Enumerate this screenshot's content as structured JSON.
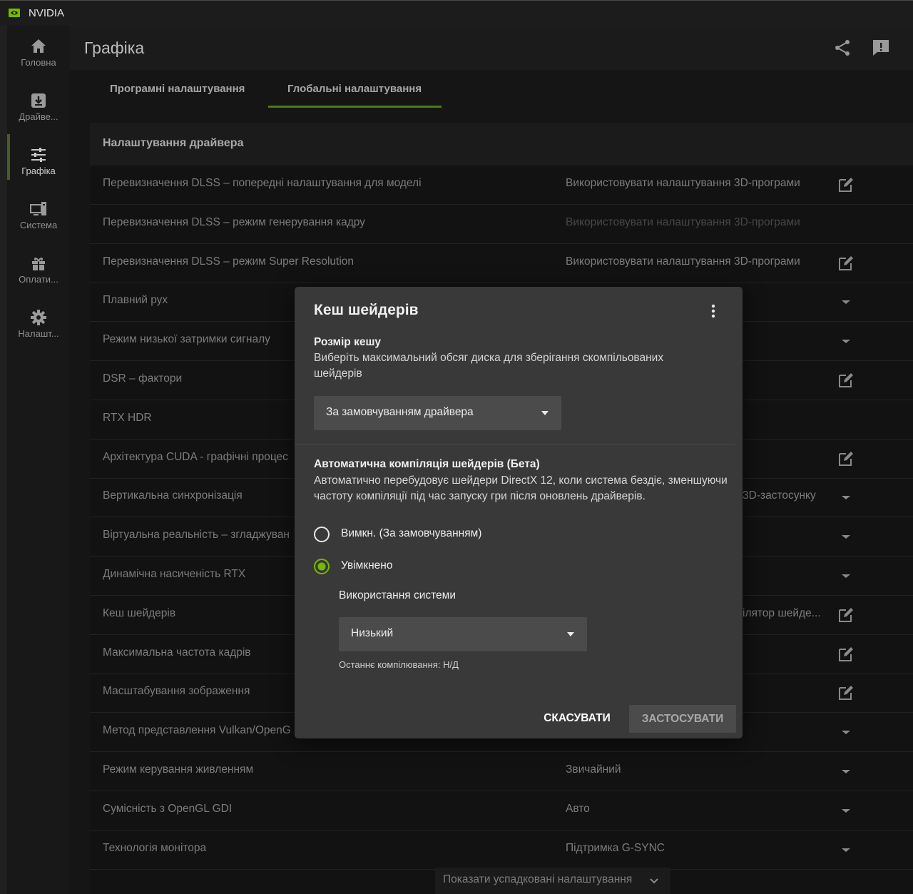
{
  "app": {
    "name": "NVIDIA",
    "accent": "#76b900"
  },
  "sidebar": {
    "items": [
      {
        "label": "Головна",
        "icon": "home-icon"
      },
      {
        "label": "Драйве...",
        "icon": "driver-download-icon"
      },
      {
        "label": "Графіка",
        "icon": "sliders-icon",
        "active": true
      },
      {
        "label": "Система",
        "icon": "system-icon"
      },
      {
        "label": "Оплати...",
        "icon": "gift-icon"
      },
      {
        "label": "Налашт...",
        "icon": "gear-icon"
      }
    ]
  },
  "header": {
    "title": "Графіка",
    "icons": [
      "share-icon",
      "feedback-icon"
    ]
  },
  "tabs": [
    {
      "label": "Програмні налаштування"
    },
    {
      "label": "Глобальні налаштування",
      "active": true
    }
  ],
  "panel": {
    "title": "Налаштування драйвера",
    "rows": [
      {
        "name": "Перевизначення DLSS – попередні налаштування для моделі",
        "value": "Використовувати налаштування 3D-програми",
        "action": "edit-icon"
      },
      {
        "name": "Перевизначення DLSS – режим генерування кадру",
        "value": "Використовувати налаштування 3D-програми",
        "action": ""
      },
      {
        "name": "Перевизначення DLSS – режим Super Resolution",
        "value": "Використовувати налаштування 3D-програми",
        "action": "edit-icon"
      },
      {
        "name": "Плавний рух",
        "value": "",
        "action": "dropdown-arrow-icon"
      },
      {
        "name": "Режим низької затримки сигналу",
        "value": "",
        "action": "dropdown-arrow-icon"
      },
      {
        "name": "DSR – фактори",
        "value": "",
        "action": "edit-icon"
      },
      {
        "name": "RTX HDR",
        "value": "",
        "action": ""
      },
      {
        "name": "Архітектура CUDA - графічні процес",
        "value": "",
        "action": "edit-icon"
      },
      {
        "name": "Вертикальна синхронізація",
        "value": "3D-застосунку",
        "action": "dropdown-arrow-icon"
      },
      {
        "name": "Віртуальна реальність – згладжуван",
        "value": "",
        "action": "dropdown-arrow-icon"
      },
      {
        "name": "Динамічна насиченість RTX",
        "value": "",
        "action": "dropdown-arrow-icon"
      },
      {
        "name": "Кеш шейдерів",
        "value": "ілятор шейде...",
        "action": "edit-icon"
      },
      {
        "name": "Максимальна частота кадрів",
        "value": "",
        "action": "edit-icon"
      },
      {
        "name": "Масштабування зображення",
        "value": "",
        "action": "edit-icon"
      },
      {
        "name": "Метод представлення Vulkan/OpenG",
        "value": "",
        "action": "dropdown-arrow-icon"
      },
      {
        "name": "Режим керування живленням",
        "value": "Звичайний",
        "action": "dropdown-arrow-icon"
      },
      {
        "name": "Сумісність з OpenGL GDI",
        "value": "Авто",
        "action": "dropdown-arrow-icon"
      },
      {
        "name": "Технологія монітора",
        "value": "Підтримка G-SYNC",
        "action": "dropdown-arrow-icon"
      }
    ],
    "legacy_button": "Показати успадковані налаштування"
  },
  "dialog": {
    "title": "Кеш шейдерів",
    "cache_size": {
      "heading": "Розмір кешу",
      "description": "Виберіть максимальний обсяг диска для зберігання скомпільованих шейдерів",
      "selected": "За замовчуванням драйвера"
    },
    "auto_compile": {
      "heading": "Автоматична компіляція шейдерів (Бета)",
      "description": "Автоматично перебудовує шейдери DirectX 12, коли система бездіє, зменшуючи частоту компіляції під час запуску гри після оновлень драйверів.",
      "option_off": "Вимкн. (За замовчуванням)",
      "option_on": "Увімкнено",
      "selected": "option_on",
      "usage_label": "Використання системи",
      "usage_selected": "Низький",
      "last_compile": "Останнє компілювання: Н/Д"
    },
    "cancel_label": "СКАСУВАТИ",
    "apply_label": "ЗАСТОСУВАТИ"
  }
}
